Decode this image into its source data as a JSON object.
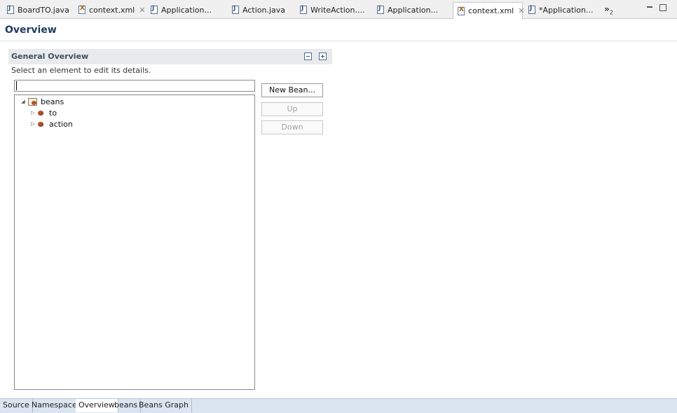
{
  "editor_tabs": [
    {
      "label": "BoardTO.java",
      "icon": "java-file-icon",
      "active": false,
      "closable": false
    },
    {
      "label": "context.xml",
      "icon": "xml-file-icon",
      "active": false,
      "closable": true
    },
    {
      "label": "Application...",
      "icon": "java-file-icon",
      "active": false,
      "closable": false
    },
    {
      "label": "Action.java",
      "icon": "java-file-icon",
      "active": false,
      "closable": false
    },
    {
      "label": "WriteAction....",
      "icon": "java-file-icon",
      "active": false,
      "closable": false
    },
    {
      "label": "Application...",
      "icon": "java-file-icon",
      "active": false,
      "closable": false
    },
    {
      "label": "context.xml",
      "icon": "xml-file-icon",
      "active": true,
      "closable": true
    },
    {
      "label": "*Application...",
      "icon": "java-file-icon",
      "active": false,
      "closable": false
    }
  ],
  "tab_close_glyph": "✕",
  "overflow": {
    "glyph": "»",
    "count": "2"
  },
  "form": {
    "title": "Overview"
  },
  "section": {
    "title": "General Overview",
    "description": "Select an element to edit its details."
  },
  "filter": {
    "value": "",
    "placeholder": ""
  },
  "tree": {
    "root": {
      "label": "beans",
      "expanded": true,
      "icon": "beans-root-icon"
    },
    "children": [
      {
        "label": "to",
        "expanded": false,
        "icon": "bean-icon"
      },
      {
        "label": "action",
        "expanded": false,
        "icon": "bean-icon"
      }
    ]
  },
  "buttons": {
    "new_bean": "New Bean...",
    "up": "Up",
    "down": "Down"
  },
  "bottom_tabs": [
    "Source",
    "Namespaces",
    "Overview",
    "beans",
    "Beans Graph"
  ],
  "active_bottom_tab": "Overview",
  "colors": {
    "form_title": "#1f3a5f",
    "section_header_bg": "#e9eaeb",
    "bottom_bar_bg": "#dbe5f1",
    "bean_icon": "#b0522a"
  }
}
